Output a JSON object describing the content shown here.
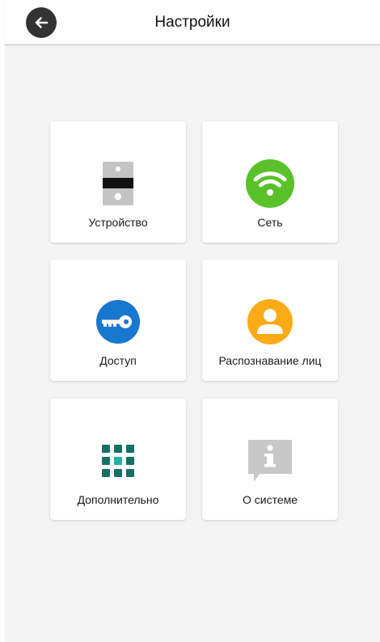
{
  "header": {
    "title": "Настройки",
    "back_icon": "arrow-left-icon"
  },
  "tiles": [
    {
      "label": "Устройство",
      "icon": "intercom-device-icon"
    },
    {
      "label": "Сеть",
      "icon": "wifi-icon",
      "color": "#5ac12a"
    },
    {
      "label": "Доступ",
      "icon": "key-icon",
      "color": "#1877cf"
    },
    {
      "label": "Распознавание лиц",
      "icon": "person-icon",
      "color": "#fbab18"
    },
    {
      "label": "Дополнительно",
      "icon": "grid-icon",
      "color": "#167067"
    },
    {
      "label": "О системе",
      "icon": "info-icon",
      "color": "#c8c8c8"
    }
  ],
  "colors": {
    "background": "#f4f4f4",
    "header_text": "#111111",
    "back_button": "#333333"
  }
}
